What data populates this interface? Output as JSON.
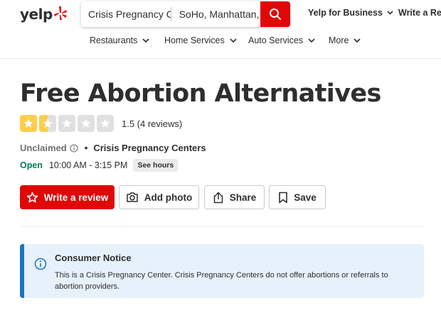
{
  "header": {
    "logo_text": "yelp",
    "search": {
      "find_value": "Crisis Pregnancy C",
      "near_value": "SoHo, Manhattan,"
    },
    "links": {
      "business": "Yelp for Business",
      "write_review": "Write a Revi"
    },
    "nav": [
      {
        "label": "Restaurants"
      },
      {
        "label": "Home Services"
      },
      {
        "label": "Auto Services"
      },
      {
        "label": "More"
      }
    ],
    "colors": {
      "brand": "#e00707"
    }
  },
  "business": {
    "name": "Free Abortion Alternatives",
    "rating": 1.5,
    "rating_text": "1.5 (4 reviews)",
    "claim_status": "Unclaimed",
    "separator": "•",
    "category": "Crisis Pregnancy Centers",
    "open_status": "Open",
    "hours": "10:00 AM - 3:15 PM",
    "see_hours": "See hours",
    "colors": {
      "star_filled": "#ffcc4b",
      "open": "#008055"
    }
  },
  "actions": {
    "write_review": "Write a review",
    "add_photo": "Add photo",
    "share": "Share",
    "save": "Save"
  },
  "notice": {
    "title": "Consumer Notice",
    "body": "This is a Crisis Pregnancy Center. Crisis Pregnancy Centers do not offer abortions or referrals to abortion providers.",
    "colors": {
      "background": "#e7f1fb",
      "accent": "#1a73c1"
    }
  }
}
